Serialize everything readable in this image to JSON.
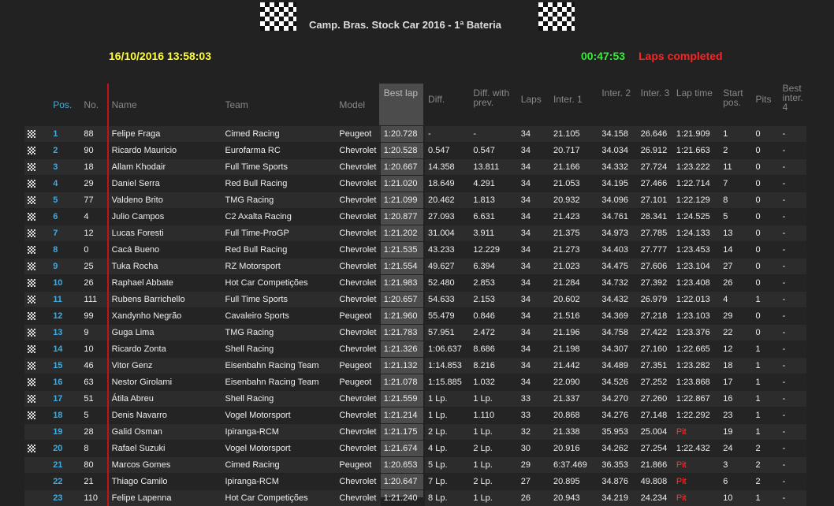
{
  "header": {
    "title": "Camp. Bras. Stock Car 2016 - 1ª Bateria",
    "datetime": "16/10/2016 13:58:03",
    "race_time": "00:47:53",
    "status": "Laps completed"
  },
  "columns": {
    "pos": "Pos.",
    "no": "No.",
    "name": "Name",
    "team": "Team",
    "model": "Model",
    "best_lap": "Best lap",
    "diff": "Diff.",
    "diff_prev": "Diff. with prev.",
    "laps": "Laps",
    "inter1": "Inter. 1",
    "inter2": "Inter. 2",
    "inter3": "Inter. 3",
    "lap_time": "Lap time",
    "start_pos": "Start pos.",
    "pits": "Pits",
    "best_inter4": "Best inter. 4"
  },
  "rows": [
    {
      "flag": true,
      "pos": "1",
      "no": "88",
      "name": "Felipe Fraga",
      "team": "Cimed Racing",
      "model": "Peugeot",
      "best_lap": "1:20.728",
      "diff": "-",
      "diff_prev": "-",
      "laps": "34",
      "inter1": "21.105",
      "inter2": "34.158",
      "inter3": "26.646",
      "lap_time": "1:21.909",
      "start_pos": "1",
      "pits": "0",
      "best_inter4": "-"
    },
    {
      "flag": true,
      "pos": "2",
      "no": "90",
      "name": "Ricardo Mauricio",
      "team": "Eurofarma RC",
      "model": "Chevrolet",
      "best_lap": "1:20.528",
      "diff": "0.547",
      "diff_prev": "0.547",
      "laps": "34",
      "inter1": "20.717",
      "inter2": "34.034",
      "inter3": "26.912",
      "lap_time": "1:21.663",
      "start_pos": "2",
      "pits": "0",
      "best_inter4": "-"
    },
    {
      "flag": true,
      "pos": "3",
      "no": "18",
      "name": "Allam Khodair",
      "team": "Full Time Sports",
      "model": "Chevrolet",
      "best_lap": "1:20.667",
      "diff": "14.358",
      "diff_prev": "13.811",
      "laps": "34",
      "inter1": "21.166",
      "inter2": "34.332",
      "inter3": "27.724",
      "lap_time": "1:23.222",
      "start_pos": "11",
      "pits": "0",
      "best_inter4": "-"
    },
    {
      "flag": true,
      "pos": "4",
      "no": "29",
      "name": "Daniel Serra",
      "team": "Red Bull Racing",
      "model": "Chevrolet",
      "best_lap": "1:21.020",
      "diff": "18.649",
      "diff_prev": "4.291",
      "laps": "34",
      "inter1": "21.053",
      "inter2": "34.195",
      "inter3": "27.466",
      "lap_time": "1:22.714",
      "start_pos": "7",
      "pits": "0",
      "best_inter4": "-"
    },
    {
      "flag": true,
      "pos": "5",
      "no": "77",
      "name": "Valdeno Brito",
      "team": "TMG Racing",
      "model": "Chevrolet",
      "best_lap": "1:21.099",
      "diff": "20.462",
      "diff_prev": "1.813",
      "laps": "34",
      "inter1": "20.932",
      "inter2": "34.096",
      "inter3": "27.101",
      "lap_time": "1:22.129",
      "start_pos": "8",
      "pits": "0",
      "best_inter4": "-"
    },
    {
      "flag": true,
      "pos": "6",
      "no": "4",
      "name": "Julio Campos",
      "team": "C2 Axalta Racing",
      "model": "Chevrolet",
      "best_lap": "1:20.877",
      "diff": "27.093",
      "diff_prev": "6.631",
      "laps": "34",
      "inter1": "21.423",
      "inter2": "34.761",
      "inter3": "28.341",
      "lap_time": "1:24.525",
      "start_pos": "5",
      "pits": "0",
      "best_inter4": "-"
    },
    {
      "flag": true,
      "pos": "7",
      "no": "12",
      "name": "Lucas Foresti",
      "team": "Full Time-ProGP",
      "model": "Chevrolet",
      "best_lap": "1:21.202",
      "diff": "31.004",
      "diff_prev": "3.911",
      "laps": "34",
      "inter1": "21.375",
      "inter2": "34.973",
      "inter3": "27.785",
      "lap_time": "1:24.133",
      "start_pos": "13",
      "pits": "0",
      "best_inter4": "-"
    },
    {
      "flag": true,
      "pos": "8",
      "no": "0",
      "name": "Cacá Bueno",
      "team": "Red Bull Racing",
      "model": "Chevrolet",
      "best_lap": "1:21.535",
      "diff": "43.233",
      "diff_prev": "12.229",
      "laps": "34",
      "inter1": "21.273",
      "inter2": "34.403",
      "inter3": "27.777",
      "lap_time": "1:23.453",
      "start_pos": "14",
      "pits": "0",
      "best_inter4": "-"
    },
    {
      "flag": true,
      "pos": "9",
      "no": "25",
      "name": "Tuka Rocha",
      "team": "RZ Motorsport",
      "model": "Chevrolet",
      "best_lap": "1:21.554",
      "diff": "49.627",
      "diff_prev": "6.394",
      "laps": "34",
      "inter1": "21.023",
      "inter2": "34.475",
      "inter3": "27.606",
      "lap_time": "1:23.104",
      "start_pos": "27",
      "pits": "0",
      "best_inter4": "-"
    },
    {
      "flag": true,
      "pos": "10",
      "no": "26",
      "name": "Raphael Abbate",
      "team": "Hot Car Competições",
      "model": "Chevrolet",
      "best_lap": "1:21.983",
      "diff": "52.480",
      "diff_prev": "2.853",
      "laps": "34",
      "inter1": "21.284",
      "inter2": "34.732",
      "inter3": "27.392",
      "lap_time": "1:23.408",
      "start_pos": "26",
      "pits": "0",
      "best_inter4": "-"
    },
    {
      "flag": true,
      "pos": "11",
      "no": "111",
      "name": "Rubens Barrichello",
      "team": "Full Time Sports",
      "model": "Chevrolet",
      "best_lap": "1:20.657",
      "diff": "54.633",
      "diff_prev": "2.153",
      "laps": "34",
      "inter1": "20.602",
      "inter2": "34.432",
      "inter3": "26.979",
      "lap_time": "1:22.013",
      "start_pos": "4",
      "pits": "1",
      "best_inter4": "-"
    },
    {
      "flag": true,
      "pos": "12",
      "no": "99",
      "name": "Xandynho Negrão",
      "team": "Cavaleiro Sports",
      "model": "Peugeot",
      "best_lap": "1:21.960",
      "diff": "55.479",
      "diff_prev": "0.846",
      "laps": "34",
      "inter1": "21.516",
      "inter2": "34.369",
      "inter3": "27.218",
      "lap_time": "1:23.103",
      "start_pos": "29",
      "pits": "0",
      "best_inter4": "-"
    },
    {
      "flag": true,
      "pos": "13",
      "no": "9",
      "name": "Guga Lima",
      "team": "TMG Racing",
      "model": "Chevrolet",
      "best_lap": "1:21.783",
      "diff": "57.951",
      "diff_prev": "2.472",
      "laps": "34",
      "inter1": "21.196",
      "inter2": "34.758",
      "inter3": "27.422",
      "lap_time": "1:23.376",
      "start_pos": "22",
      "pits": "0",
      "best_inter4": "-"
    },
    {
      "flag": true,
      "pos": "14",
      "no": "10",
      "name": "Ricardo Zonta",
      "team": "Shell Racing",
      "model": "Chevrolet",
      "best_lap": "1:21.326",
      "diff": "1:06.637",
      "diff_prev": "8.686",
      "laps": "34",
      "inter1": "21.198",
      "inter2": "34.307",
      "inter3": "27.160",
      "lap_time": "1:22.665",
      "start_pos": "12",
      "pits": "1",
      "best_inter4": "-"
    },
    {
      "flag": true,
      "pos": "15",
      "no": "46",
      "name": "Vitor Genz",
      "team": "Eisenbahn Racing Team",
      "model": "Peugeot",
      "best_lap": "1:21.132",
      "diff": "1:14.853",
      "diff_prev": "8.216",
      "laps": "34",
      "inter1": "21.442",
      "inter2": "34.489",
      "inter3": "27.351",
      "lap_time": "1:23.282",
      "start_pos": "18",
      "pits": "1",
      "best_inter4": "-"
    },
    {
      "flag": true,
      "pos": "16",
      "no": "63",
      "name": "Nestor Girolami",
      "team": "Eisenbahn Racing Team",
      "model": "Peugeot",
      "best_lap": "1:21.078",
      "diff": "1:15.885",
      "diff_prev": "1.032",
      "laps": "34",
      "inter1": "22.090",
      "inter2": "34.526",
      "inter3": "27.252",
      "lap_time": "1:23.868",
      "start_pos": "17",
      "pits": "1",
      "best_inter4": "-"
    },
    {
      "flag": true,
      "pos": "17",
      "no": "51",
      "name": "Átila Abreu",
      "team": "Shell Racing",
      "model": "Chevrolet",
      "best_lap": "1:21.559",
      "diff": "1 Lp.",
      "diff_prev": "1 Lp.",
      "laps": "33",
      "inter1": "21.337",
      "inter2": "34.270",
      "inter3": "27.260",
      "lap_time": "1:22.867",
      "start_pos": "16",
      "pits": "1",
      "best_inter4": "-"
    },
    {
      "flag": true,
      "pos": "18",
      "no": "5",
      "name": "Denis Navarro",
      "team": "Vogel Motorsport",
      "model": "Chevrolet",
      "best_lap": "1:21.214",
      "diff": "1 Lp.",
      "diff_prev": "1.110",
      "laps": "33",
      "inter1": "20.868",
      "inter2": "34.276",
      "inter3": "27.148",
      "lap_time": "1:22.292",
      "start_pos": "23",
      "pits": "1",
      "best_inter4": "-"
    },
    {
      "flag": false,
      "pos": "19",
      "no": "28",
      "name": "Galid Osman",
      "team": "Ipiranga-RCM",
      "model": "Chevrolet",
      "best_lap": "1:21.175",
      "diff": "2 Lp.",
      "diff_prev": "1 Lp.",
      "laps": "32",
      "inter1": "21.338",
      "inter2": "35.953",
      "inter3": "25.004",
      "lap_time": "Pit",
      "start_pos": "19",
      "pits": "1",
      "best_inter4": "-"
    },
    {
      "flag": true,
      "pos": "20",
      "no": "8",
      "name": "Rafael Suzuki",
      "team": "Vogel Motorsport",
      "model": "Chevrolet",
      "best_lap": "1:21.674",
      "diff": "4 Lp.",
      "diff_prev": "2 Lp.",
      "laps": "30",
      "inter1": "20.916",
      "inter2": "34.262",
      "inter3": "27.254",
      "lap_time": "1:22.432",
      "start_pos": "24",
      "pits": "2",
      "best_inter4": "-"
    },
    {
      "flag": false,
      "pos": "21",
      "no": "80",
      "name": "Marcos Gomes",
      "team": "Cimed Racing",
      "model": "Peugeot",
      "best_lap": "1:20.653",
      "diff": "5 Lp.",
      "diff_prev": "1 Lp.",
      "laps": "29",
      "inter1": "6:37.469",
      "inter2": "36.353",
      "inter3": "21.866",
      "lap_time": "Pit",
      "start_pos": "3",
      "pits": "2",
      "best_inter4": "-"
    },
    {
      "flag": false,
      "pos": "22",
      "no": "21",
      "name": "Thiago Camilo",
      "team": "Ipiranga-RCM",
      "model": "Chevrolet",
      "best_lap": "1:20.647",
      "diff": "7 Lp.",
      "diff_prev": "2 Lp.",
      "laps": "27",
      "inter1": "20.895",
      "inter2": "34.876",
      "inter3": "49.808",
      "lap_time": "Pit",
      "start_pos": "6",
      "pits": "2",
      "best_inter4": "-"
    },
    {
      "flag": false,
      "pos": "23",
      "no": "110",
      "name": "Felipe Lapenna",
      "team": "Hot Car Competições",
      "model": "Chevrolet",
      "best_lap": "1:21.240",
      "diff": "8 Lp.",
      "diff_prev": "1 Lp.",
      "laps": "26",
      "inter1": "20.943",
      "inter2": "34.219",
      "inter3": "24.234",
      "lap_time": "Pit",
      "start_pos": "10",
      "pits": "1",
      "best_inter4": "-"
    }
  ]
}
